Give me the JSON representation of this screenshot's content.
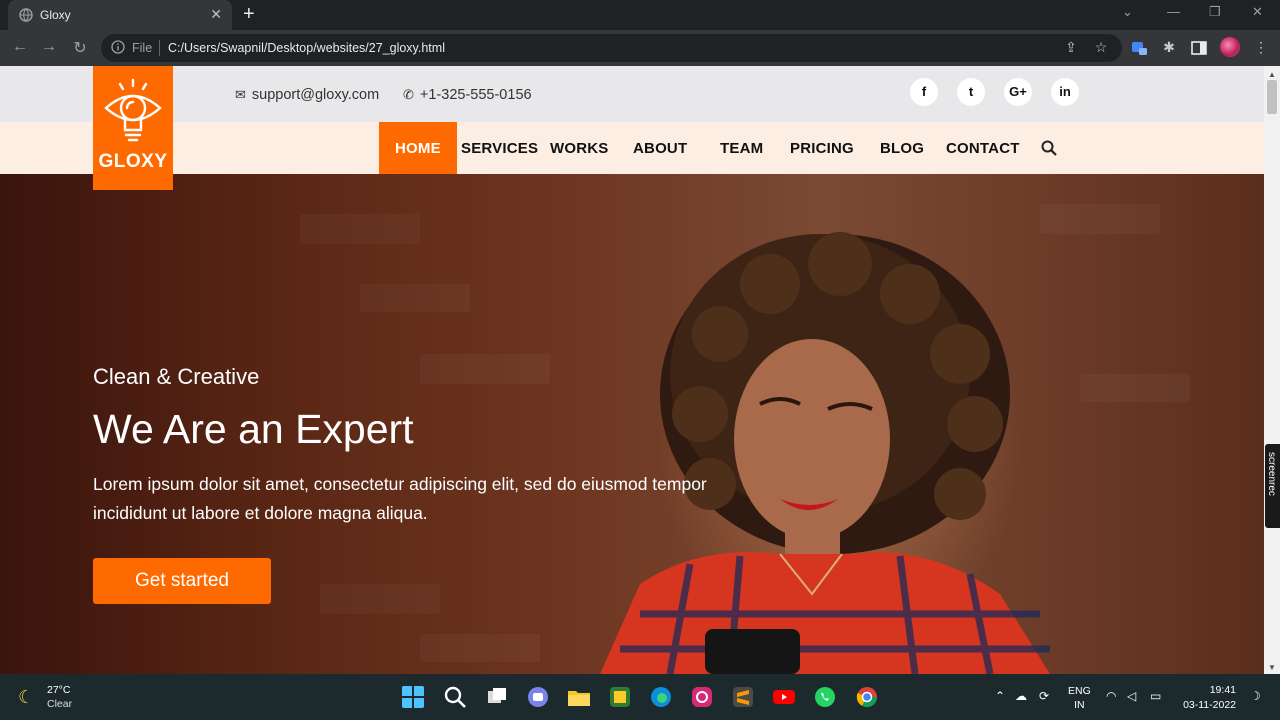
{
  "browser": {
    "tab_title": "Gloxy",
    "tab_close": "✕",
    "new_tab": "+",
    "scheme_label": "File",
    "url": "C:/Users/Swapnil/Desktop/websites/27_gloxy.html"
  },
  "site": {
    "logo_text": "GLOXY",
    "email": "support@gloxy.com",
    "phone": "+1-325-555-0156",
    "social": [
      "f",
      "t",
      "G+",
      "in"
    ],
    "nav": [
      "HOME",
      "SERVICES",
      "WORKS",
      "ABOUT",
      "TEAM",
      "PRICING",
      "BLOG",
      "CONTACT"
    ],
    "active_nav": "HOME",
    "hero": {
      "subtitle": "Clean & Creative",
      "title": "We Are an Expert",
      "text": "Lorem ipsum dolor sit amet, consectetur adipiscing elit, sed do eiusmod tempor incididunt ut labore et dolore magna aliqua.",
      "cta": "Get started"
    },
    "accent_color": "#ff6a00"
  },
  "overlay": {
    "label": "screenrec"
  },
  "taskbar": {
    "temperature": "27°C",
    "condition": "Clear",
    "lang_top": "ENG",
    "lang_bottom": "IN",
    "time": "19:41",
    "date": "03-11-2022",
    "apps": [
      "start-icon",
      "search-icon",
      "task-view-icon",
      "teams-chat-icon",
      "file-explorer-icon",
      "camtasia-icon",
      "edge-icon",
      "instagram-icon",
      "sublime-text-icon",
      "youtube-icon",
      "whatsapp-icon",
      "chrome-icon"
    ]
  }
}
